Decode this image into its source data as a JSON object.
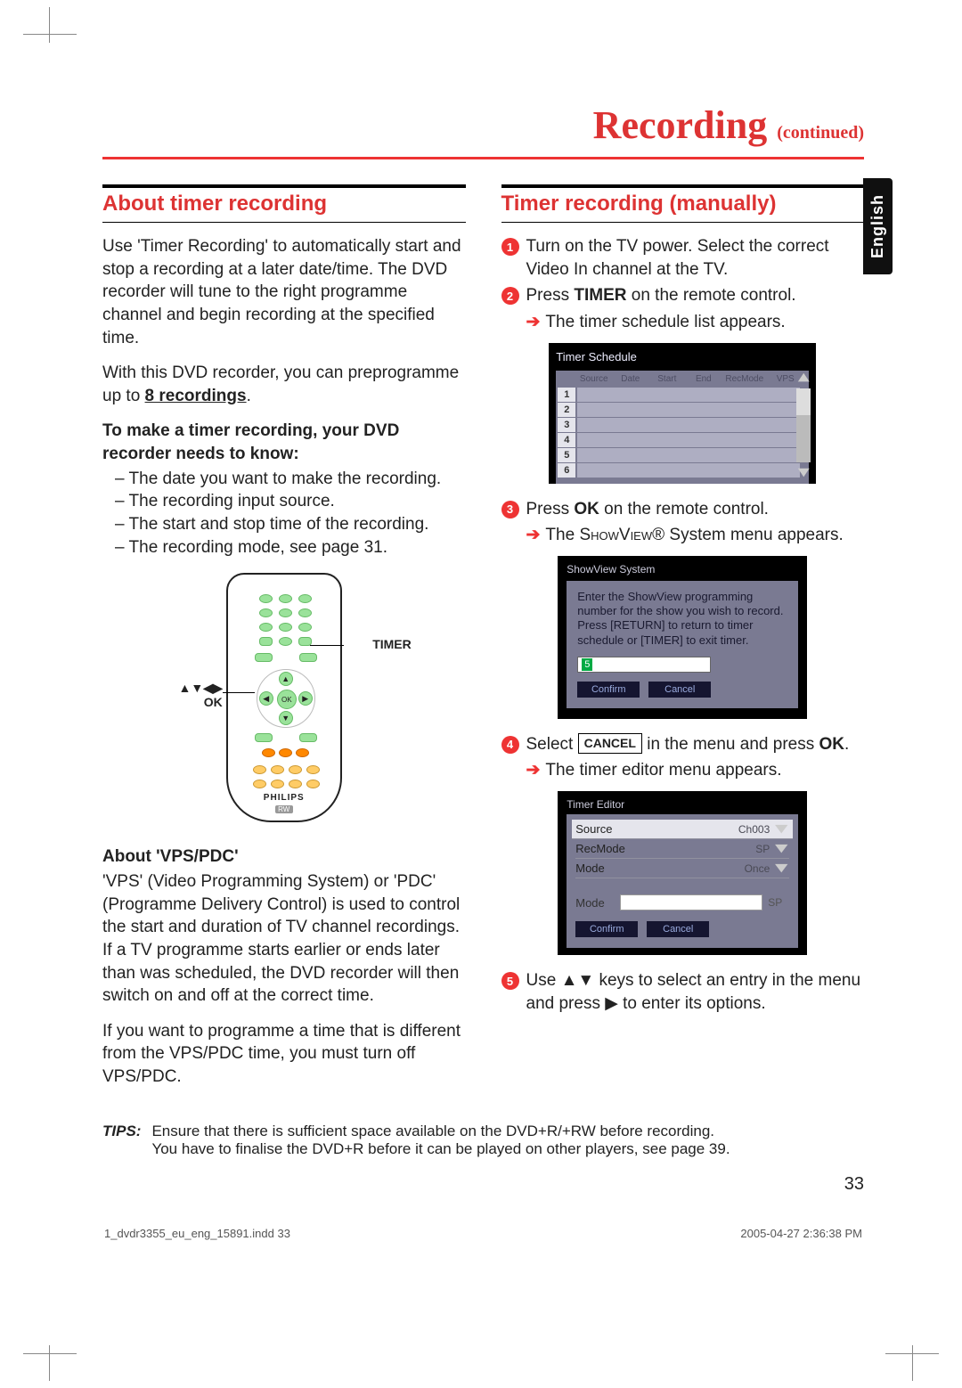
{
  "pageTitle": "Recording",
  "pageTitleCont": "(continued)",
  "sideTab": "English",
  "left": {
    "heading": "About timer recording",
    "p1": "Use 'Timer Recording' to automatically start and stop a recording at a later date/time. The DVD recorder will tune to the right programme channel and begin recording at the specified time.",
    "p2a": "With this DVD recorder, you can preprogramme up to ",
    "p2b": "8 recordings",
    "p2c": ".",
    "sub1a": "To make a timer recording, your DVD recorder needs to know:",
    "li1": "The date you want to make the recording.",
    "li2": "The recording input source.",
    "li3": "The start and stop time of the recording.",
    "li4": "The recording mode, see page 31.",
    "remote": {
      "okLabelArrows": "▲▼◀▶",
      "okLabel": "OK",
      "timerLabel": "TIMER",
      "brand": "PHILIPS",
      "rw": "RW"
    },
    "vpsHead": "About 'VPS/PDC'",
    "vpsP1": "'VPS' (Video Programming System) or 'PDC' (Programme Delivery Control) is used to control the start and duration of TV channel recordings. If a TV programme starts earlier or ends later than was scheduled, the DVD recorder will then switch on and off at the correct time.",
    "vpsP2": "If you want to programme a time that is different from the VPS/PDC time, you must turn off VPS/PDC."
  },
  "right": {
    "heading": "Timer recording (manually)",
    "step1": "Turn on the TV power. Select the correct Video In channel at the TV.",
    "step2a": "Press ",
    "step2b": "TIMER",
    "step2c": " on the remote control.",
    "step2arrow": "The timer schedule list appears.",
    "sched": {
      "title": "Timer Schedule",
      "cols": [
        "Source",
        "Date",
        "Start",
        "End",
        "RecMode",
        "VPS"
      ],
      "rows": [
        "1",
        "2",
        "3",
        "4",
        "5",
        "6"
      ]
    },
    "step3a": "Press ",
    "step3b": "OK",
    "step3c": " on the remote control.",
    "step3arrowA": "The ",
    "step3arrowB": "ShowView",
    "step3arrowC": "® System menu appears.",
    "sv": {
      "title": "ShowView System",
      "msg": "Enter the ShowView programming number for the show you wish to record. Press [RETURN] to return to timer schedule or [TIMER] to exit timer.",
      "digit": "5",
      "confirm": "Confirm",
      "cancel": "Cancel"
    },
    "step4a": "Select ",
    "step4box": "CANCEL",
    "step4b": " in the menu and press ",
    "step4c": "OK",
    "step4d": ".",
    "step4arrow": "The timer editor menu appears.",
    "editor": {
      "title": "Timer Editor",
      "rows": [
        {
          "lab": "Source",
          "val": "Ch003"
        },
        {
          "lab": "RecMode",
          "val": "SP"
        },
        {
          "lab": "Mode",
          "val": "Once"
        }
      ],
      "modeLabel": "Mode",
      "modeVal": "SP",
      "confirm": "Confirm",
      "cancel": "Cancel"
    },
    "step5a": "Use ▲▼ keys to select an entry in the menu and press ▶ to enter its options."
  },
  "tips": {
    "label": "TIPS:",
    "l1": "Ensure that there is sufficient space available on the DVD+R/+RW before recording.",
    "l2": "You have to finalise the DVD+R before it can be played on other players, see page 39."
  },
  "footer": {
    "pageNum": "33",
    "indd": "1_dvdr3355_eu_eng_15891.indd   33",
    "ts": "2005-04-27   2:36:38 PM"
  }
}
